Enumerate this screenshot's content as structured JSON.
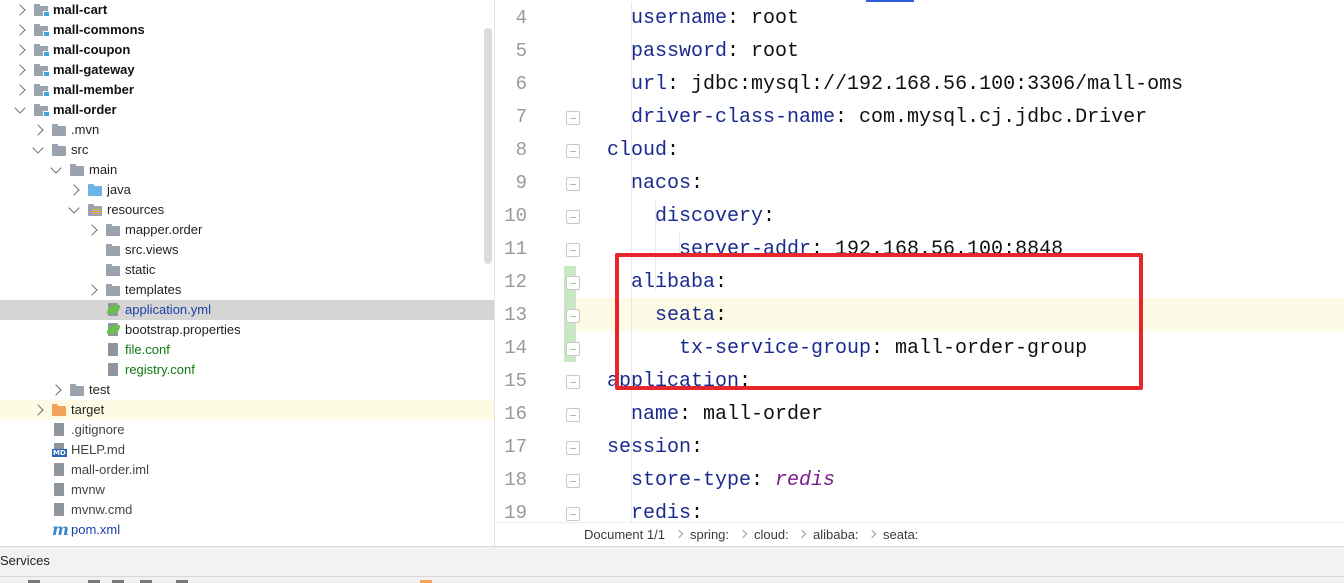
{
  "project_tree": {
    "items": [
      {
        "label": "mall-cart",
        "type": "module",
        "expanded": false
      },
      {
        "label": "mall-commons",
        "type": "module",
        "expanded": false
      },
      {
        "label": "mall-coupon",
        "type": "module",
        "expanded": false
      },
      {
        "label": "mall-gateway",
        "type": "module",
        "expanded": false
      },
      {
        "label": "mall-member",
        "type": "module",
        "expanded": false
      },
      {
        "label": "mall-order",
        "type": "module",
        "expanded": true
      },
      {
        "label": ".mvn",
        "type": "folder",
        "expanded": false
      },
      {
        "label": "src",
        "type": "folder",
        "expanded": true
      },
      {
        "label": "main",
        "type": "folder",
        "expanded": true
      },
      {
        "label": "java",
        "type": "source-folder",
        "expanded": false
      },
      {
        "label": "resources",
        "type": "resource-folder",
        "expanded": true
      },
      {
        "label": "mapper.order",
        "type": "folder",
        "expanded": false
      },
      {
        "label": "src.views",
        "type": "folder"
      },
      {
        "label": "static",
        "type": "folder"
      },
      {
        "label": "templates",
        "type": "folder",
        "expanded": false
      },
      {
        "label": "application.yml",
        "type": "spring-config",
        "selected": true
      },
      {
        "label": "bootstrap.properties",
        "type": "spring-config"
      },
      {
        "label": "file.conf",
        "type": "conf-file"
      },
      {
        "label": "registry.conf",
        "type": "conf-file"
      },
      {
        "label": "test",
        "type": "folder",
        "expanded": false
      },
      {
        "label": "target",
        "type": "excluded-folder",
        "expanded": false
      },
      {
        "label": ".gitignore",
        "type": "file"
      },
      {
        "label": "HELP.md",
        "type": "markdown-file"
      },
      {
        "label": "mall-order.iml",
        "type": "file"
      },
      {
        "label": "mvnw",
        "type": "file"
      },
      {
        "label": "mvnw.cmd",
        "type": "file"
      },
      {
        "label": "pom.xml",
        "type": "maven-file"
      }
    ]
  },
  "editor": {
    "lines": [
      {
        "num": "4",
        "text": [
          {
            "k": "username"
          },
          {
            "t": ": root"
          }
        ]
      },
      {
        "num": "5",
        "text": [
          {
            "k": "password"
          },
          {
            "t": ": root"
          }
        ]
      },
      {
        "num": "6",
        "text": [
          {
            "k": "url"
          },
          {
            "t": ": jdbc:mysql://192.168.56.100:3306/mall-oms"
          }
        ]
      },
      {
        "num": "7",
        "text": [
          {
            "k": "driver-class-name"
          },
          {
            "t": ": com.mysql.cj.jdbc.Driver"
          }
        ]
      },
      {
        "num": "8",
        "text": [
          {
            "k": "cloud"
          },
          {
            "t": ":"
          }
        ]
      },
      {
        "num": "9",
        "text": [
          {
            "k": "nacos"
          },
          {
            "t": ":"
          }
        ]
      },
      {
        "num": "10",
        "text": [
          {
            "k": "discovery"
          },
          {
            "t": ":"
          }
        ]
      },
      {
        "num": "11",
        "text": [
          {
            "k": "server-addr"
          },
          {
            "t": ": 192.168.56.100:8848"
          }
        ]
      },
      {
        "num": "12",
        "text": [
          {
            "k": "alibaba"
          },
          {
            "t": ":"
          }
        ]
      },
      {
        "num": "13",
        "text": [
          {
            "k": "seata"
          },
          {
            "t": ":"
          }
        ]
      },
      {
        "num": "14",
        "text": [
          {
            "k": "tx-service-group"
          },
          {
            "t": ": mall-order-group"
          }
        ]
      },
      {
        "num": "15",
        "text": [
          {
            "k": "application"
          },
          {
            "t": ":"
          }
        ]
      },
      {
        "num": "16",
        "text": [
          {
            "k": "name"
          },
          {
            "t": ": mall-order"
          }
        ]
      },
      {
        "num": "17",
        "text": [
          {
            "k": "session"
          },
          {
            "t": ":"
          }
        ]
      },
      {
        "num": "18",
        "text": [
          {
            "k": "store-type"
          },
          {
            "t": ": "
          },
          {
            "i": "redis"
          }
        ]
      },
      {
        "num": "19",
        "text": [
          {
            "k": "redis"
          },
          {
            "t": ":"
          }
        ]
      }
    ]
  },
  "breadcrumb": [
    "Document 1/1",
    "spring:",
    "cloud:",
    "alibaba:",
    "seata:"
  ],
  "bottom_panel": {
    "title": "Services"
  },
  "colors": {
    "yaml_key": "#1b2a8f",
    "yaml_italic_value": "#7a1f8c",
    "highlight_box": "#e5262d",
    "selection": "#d5d5d5"
  }
}
